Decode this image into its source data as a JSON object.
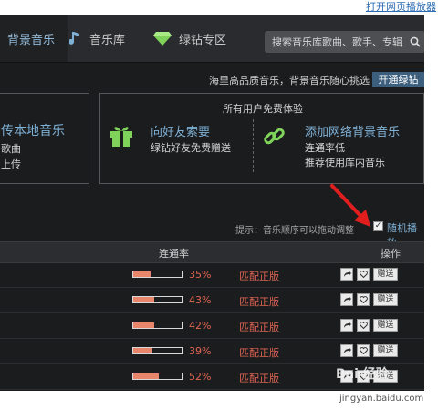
{
  "top_link": "打开网页播放器",
  "nav": {
    "tabs": [
      {
        "label": "背景音乐",
        "icon": "background-music-icon"
      },
      {
        "label": "音乐库",
        "icon": "music-note-icon"
      },
      {
        "label": "绿钻专区",
        "icon": "green-diamond-icon"
      }
    ],
    "search_placeholder": "搜索音乐库歌曲、歌手、专辑"
  },
  "promo": {
    "text": "海里高品质音乐，背景音乐随心挑选",
    "button": "开通绿钻"
  },
  "panel_left": {
    "title": "传本地音乐",
    "line1": "歌曲",
    "line2": "上传"
  },
  "panel_main": {
    "header": "所有用户免费体验",
    "block1": {
      "title": "向好友索要",
      "subtitle": "绿钻好友免费赠送"
    },
    "block2": {
      "title": "添加网络背景音乐",
      "line1": "连通率低",
      "line2": "推荐使用库内音乐"
    }
  },
  "hint": "提示：音乐顺序可以拖动调整",
  "random_play": {
    "label": "随机播放",
    "checked": true
  },
  "table": {
    "headers": {
      "rate": "连通率",
      "ops": "操作"
    },
    "rows": [
      {
        "rate": 35,
        "rate_text": "35%",
        "match": "匹配正版",
        "gift": "赠送"
      },
      {
        "rate": 43,
        "rate_text": "43%",
        "match": "匹配正版",
        "gift": "赠送"
      },
      {
        "rate": 42,
        "rate_text": "42%",
        "match": "匹配正版",
        "gift": "赠送"
      },
      {
        "rate": 39,
        "rate_text": "39%",
        "match": "匹配正版",
        "gift": "赠送"
      },
      {
        "rate": 52,
        "rate_text": "52%",
        "match": "匹配正版",
        "gift": "赠送"
      }
    ]
  },
  "watermark": {
    "main": "Bai 经验",
    "url": "jingyan.baidu.com"
  },
  "colors": {
    "accent_blue": "#7fb1d6",
    "red": "#e06552",
    "bar_fill": "#e7866a",
    "button_blue": "#3d5f7e"
  }
}
